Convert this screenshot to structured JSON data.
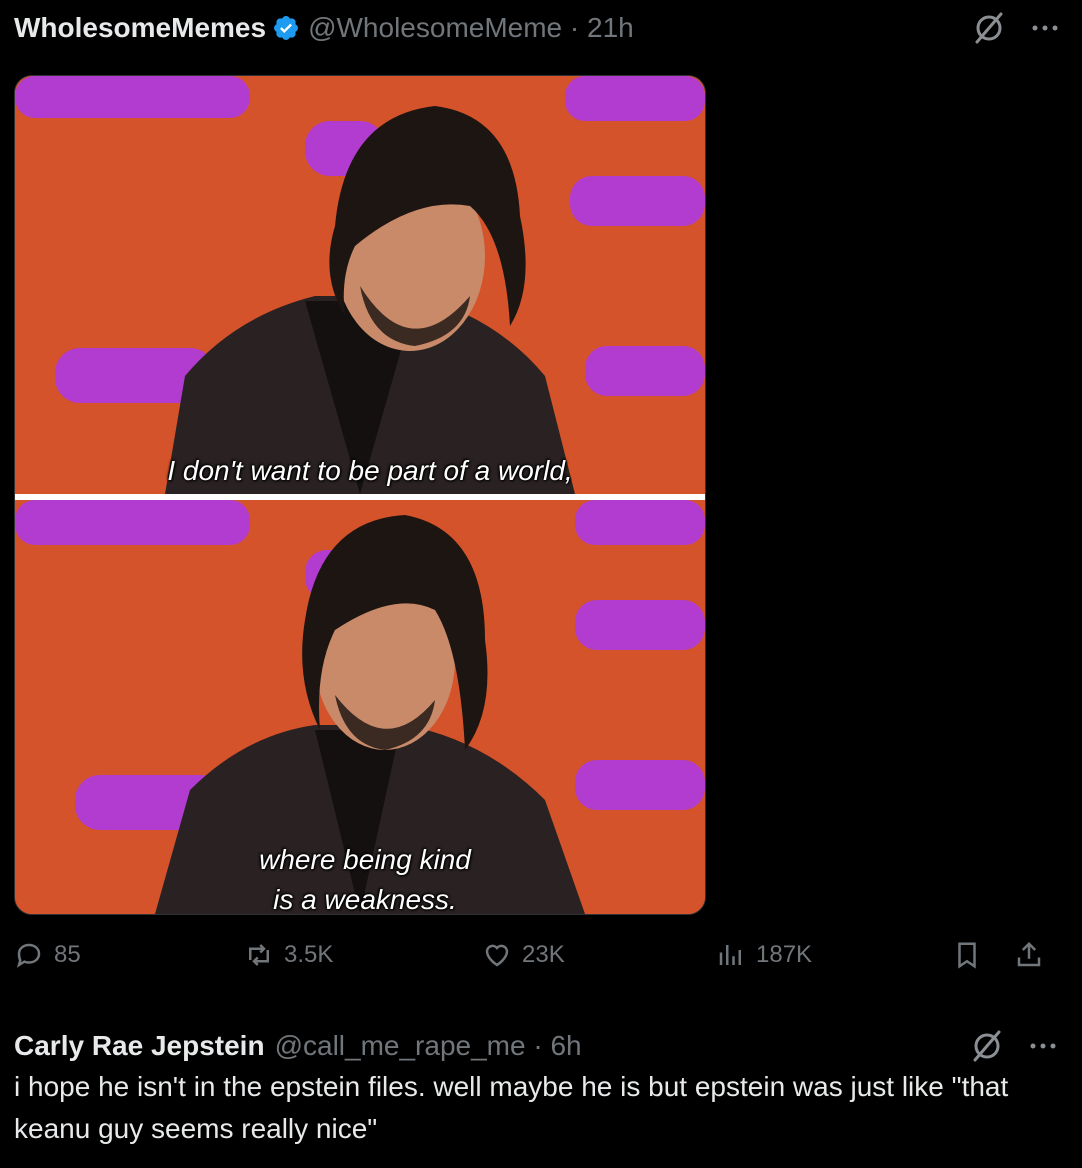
{
  "post": {
    "author_name": "WholesomeMemes",
    "author_handle": "@WholesomeMeme · 21h",
    "captions": {
      "top": "I don't want to be part of a world,",
      "bottom_line1": "where being kind",
      "bottom_line2": "is a weakness."
    },
    "stats": {
      "replies": "85",
      "reposts": "3.5K",
      "likes": "23K",
      "views": "187K"
    }
  },
  "reply": {
    "author_name": "Carly Rae Jepstein",
    "author_handle": "@call_me_rape_me · 6h",
    "text": "i hope he isn't in the epstein files. well maybe he is but epstein was just like \"that keanu guy seems really nice\""
  },
  "colors": {
    "background": "#000000",
    "text": "#e7e9ea",
    "muted": "#71767b",
    "verified": "#1d9bf0",
    "studio_orange": "#d5532a",
    "studio_purple": "#b23cd0"
  },
  "icons": [
    "verified-badge-icon",
    "grok-icon",
    "more-icon",
    "reply-icon",
    "repost-icon",
    "like-icon",
    "views-icon",
    "bookmark-icon",
    "share-icon"
  ]
}
